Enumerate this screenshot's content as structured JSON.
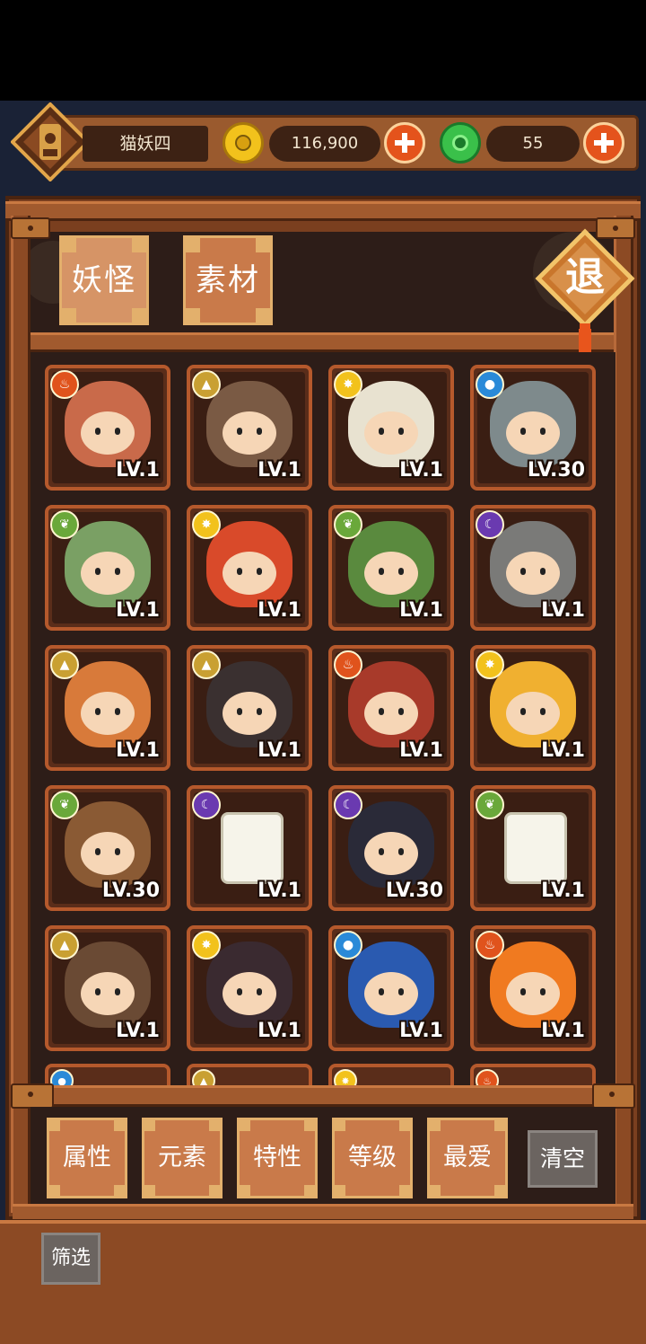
{
  "header": {
    "player_name": "猫妖四",
    "gold": "116,900",
    "jade": "55"
  },
  "tabs": [
    {
      "label": "妖怪",
      "active": true
    },
    {
      "label": "素材",
      "active": false
    }
  ],
  "exit_label": "退",
  "monsters": [
    {
      "element": "fire",
      "level": "LV.1",
      "color": "#c96a4a"
    },
    {
      "element": "earth",
      "level": "LV.1",
      "color": "#7a5a44"
    },
    {
      "element": "light",
      "level": "LV.1",
      "color": "#e8e2d0"
    },
    {
      "element": "water",
      "level": "LV.30",
      "color": "#7e8a8c"
    },
    {
      "element": "wood",
      "level": "LV.1",
      "color": "#7aa064"
    },
    {
      "element": "light",
      "level": "LV.1",
      "color": "#d94a2a"
    },
    {
      "element": "wood",
      "level": "LV.1",
      "color": "#5a8a3e"
    },
    {
      "element": "dark",
      "level": "LV.1",
      "color": "#7a7a78"
    },
    {
      "element": "earth",
      "level": "LV.1",
      "color": "#d87a3a"
    },
    {
      "element": "earth",
      "level": "LV.1",
      "color": "#3a3030"
    },
    {
      "element": "fire",
      "level": "LV.1",
      "color": "#a83a2a"
    },
    {
      "element": "light",
      "level": "LV.1",
      "color": "#f0b030"
    },
    {
      "element": "wood",
      "level": "LV.30",
      "color": "#8a5a34"
    },
    {
      "element": "dark",
      "level": "LV.1",
      "color": "#ffffff",
      "tile": true
    },
    {
      "element": "dark",
      "level": "LV.30",
      "color": "#2a2a38"
    },
    {
      "element": "wood",
      "level": "LV.1",
      "color": "#ffffff",
      "tile": true
    },
    {
      "element": "earth",
      "level": "LV.1",
      "color": "#6a4a34"
    },
    {
      "element": "light",
      "level": "LV.1",
      "color": "#3a2a30"
    },
    {
      "element": "water",
      "level": "LV.1",
      "color": "#2a5ab0"
    },
    {
      "element": "fire",
      "level": "LV.1",
      "color": "#f07a20"
    }
  ],
  "partial_row_elements": [
    "water",
    "earth",
    "light",
    "fire"
  ],
  "filters": [
    {
      "label": "属性"
    },
    {
      "label": "元素"
    },
    {
      "label": "特性"
    },
    {
      "label": "等级"
    },
    {
      "label": "最爱"
    }
  ],
  "clear_label": "清空",
  "filter_label": "筛选",
  "element_colors": {
    "fire": "#e0531c",
    "earth": "#c9a032",
    "light": "#f2c21c",
    "water": "#2a8ad8",
    "wood": "#6aa83a",
    "dark": "#6a3ab0"
  }
}
